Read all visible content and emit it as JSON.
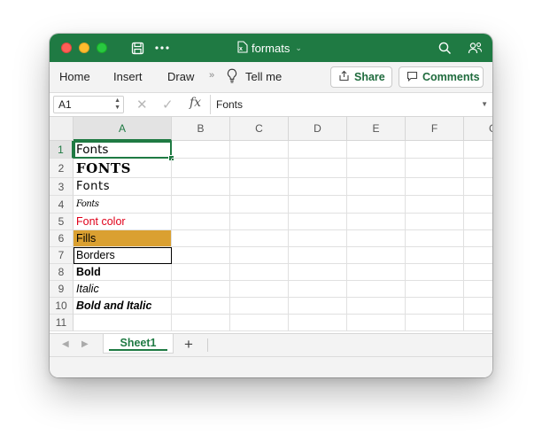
{
  "window": {
    "title": "formats",
    "title_icon": "excel-doc-icon",
    "colors": {
      "titlebar": "#1f7a43",
      "accent": "#1f7a43",
      "fill_gold": "#daa031",
      "font_red": "#e0001a"
    }
  },
  "toolbar": {
    "save_icon": "save-icon",
    "more_icon": "more-icon",
    "search_icon": "search-icon",
    "share_icon": "share-people-icon"
  },
  "ribbon": {
    "tabs": [
      "Home",
      "Insert",
      "Draw"
    ],
    "overflow_glyph": "»",
    "tell_me": "Tell me",
    "share_label": "Share",
    "comments_label": "Comments"
  },
  "formula_bar": {
    "name_box": "A1",
    "content": "Fonts"
  },
  "grid": {
    "columns": [
      "A",
      "B",
      "C",
      "D",
      "E",
      "F",
      "G"
    ],
    "selected_cell": "A1",
    "rows": [
      {
        "num": "1",
        "a": "Fonts"
      },
      {
        "num": "2",
        "a": "FONTS"
      },
      {
        "num": "3",
        "a": "Fonts"
      },
      {
        "num": "4",
        "a": "Fonts"
      },
      {
        "num": "5",
        "a": "Font color"
      },
      {
        "num": "6",
        "a": "Fills"
      },
      {
        "num": "7",
        "a": "Borders"
      },
      {
        "num": "8",
        "a": "Bold"
      },
      {
        "num": "9",
        "a": "Italic"
      },
      {
        "num": "10",
        "a": "Bold and Italic"
      },
      {
        "num": "11",
        "a": ""
      }
    ]
  },
  "sheets": {
    "tabs": [
      "Sheet1"
    ],
    "active": "Sheet1",
    "add_label": "+"
  }
}
